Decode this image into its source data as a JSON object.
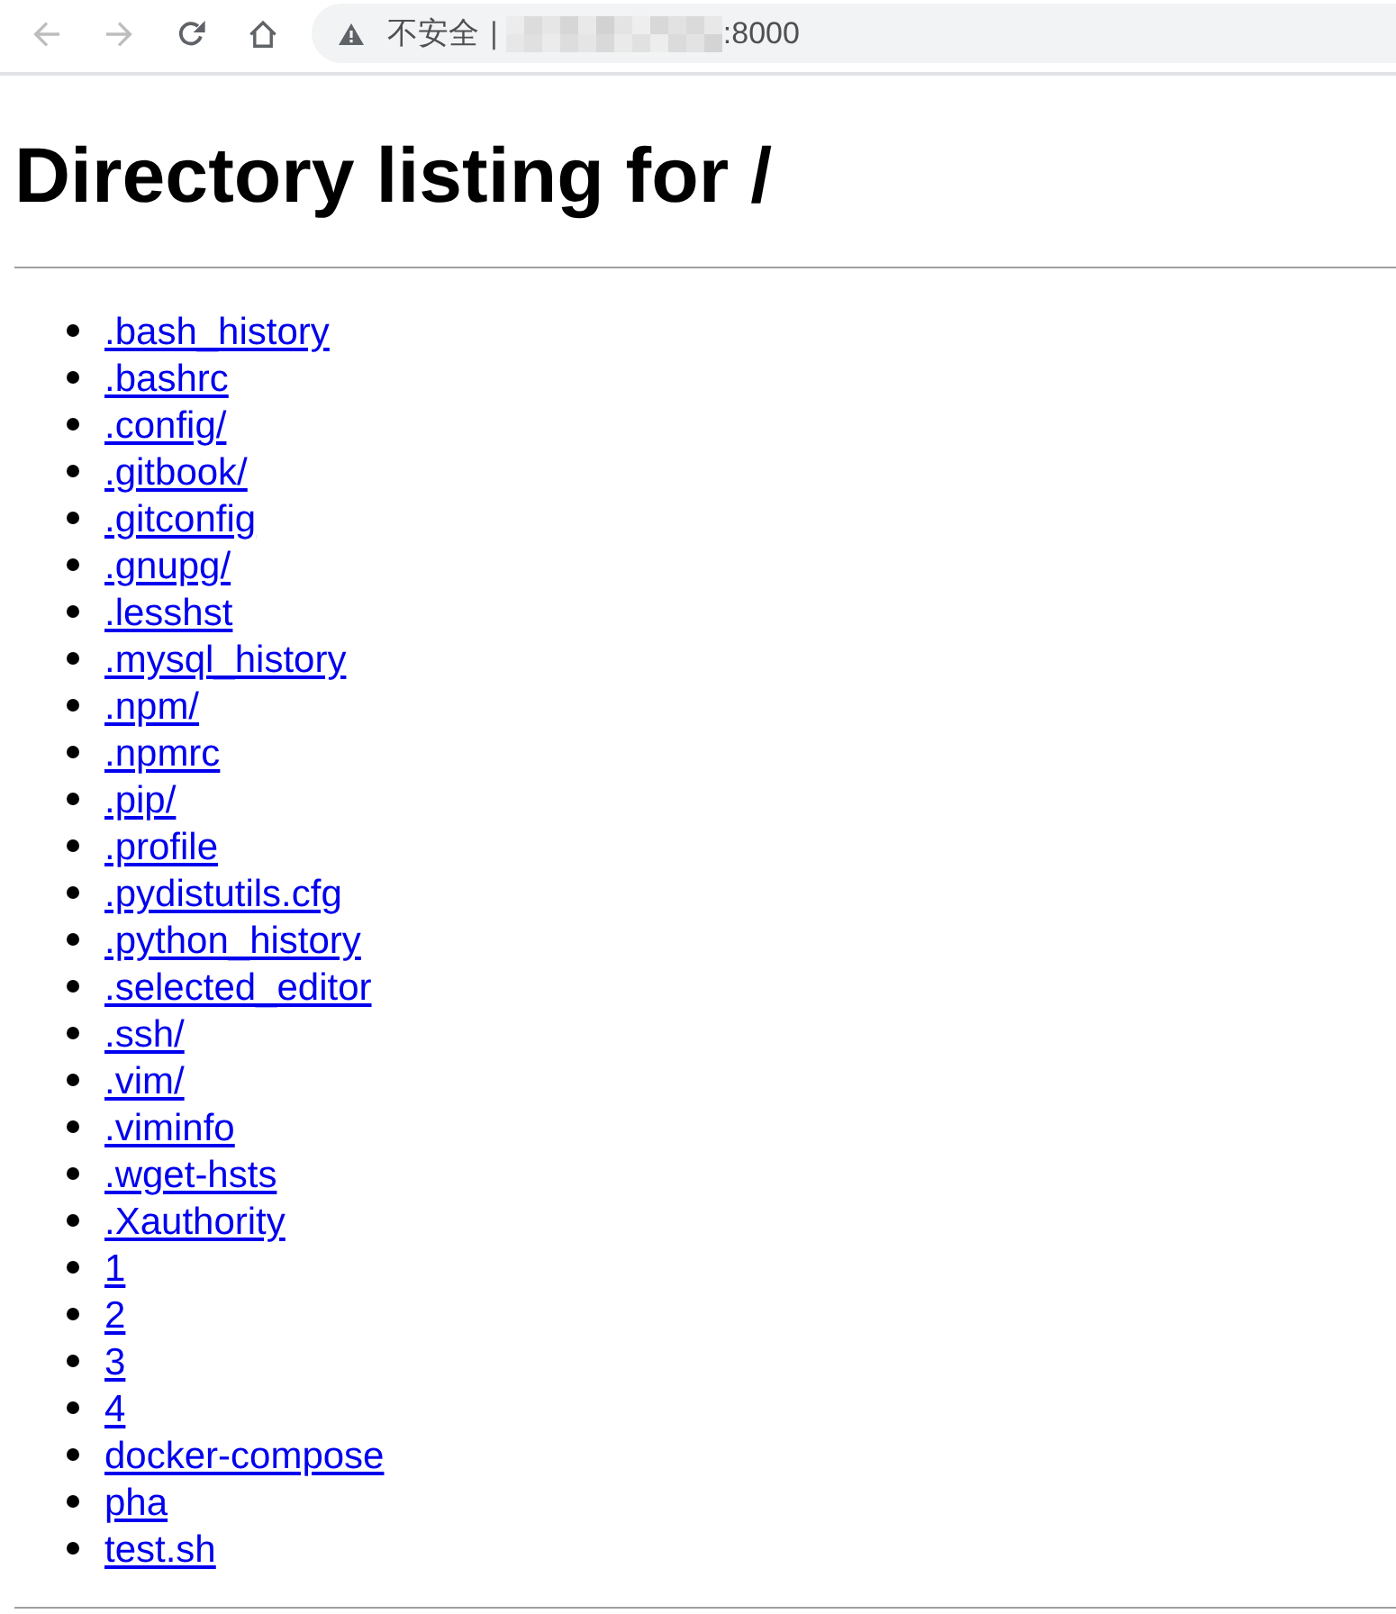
{
  "toolbar": {
    "buttons": [
      {
        "kind": "back",
        "disabled": true
      },
      {
        "kind": "forward",
        "disabled": true
      },
      {
        "kind": "reload",
        "disabled": false
      },
      {
        "kind": "home",
        "disabled": false
      }
    ],
    "address_bar": {
      "security_label": "不安全",
      "separator": "|",
      "host_redacted": true,
      "port": ":8000"
    }
  },
  "page": {
    "title": "Directory listing for /",
    "entries": [
      ".bash_history",
      ".bashrc",
      ".config/",
      ".gitbook/",
      ".gitconfig",
      ".gnupg/",
      ".lesshst",
      ".mysql_history",
      ".npm/",
      ".npmrc",
      ".pip/",
      ".profile",
      ".pydistutils.cfg",
      ".python_history",
      ".selected_editor",
      ".ssh/",
      ".vim/",
      ".viminfo",
      ".wget-hsts",
      ".Xauthority",
      "1",
      "2",
      "3",
      "4",
      "docker-compose",
      "pha",
      "test.sh"
    ]
  }
}
